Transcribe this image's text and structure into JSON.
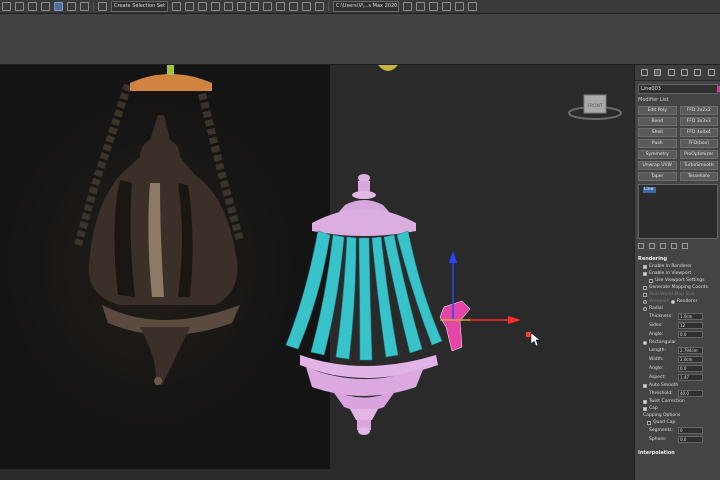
{
  "toolbar": {
    "selection_set": "Create Selection Set",
    "path": "C:\\Users\\V\\...s Max 2020"
  },
  "viewport": {
    "viewcube_label": "FRONT"
  },
  "panel": {
    "object_name": "Line003",
    "object_color": "#c2448f",
    "modifier_list_label": "Modifier List",
    "modifiers": [
      "Edit Poly",
      "FFD 2x2x2",
      "Bend",
      "FFD 3x3x3",
      "Shell",
      "FFD 4x4x4",
      "Push",
      "FFD(box)",
      "Symmetry",
      "ProOptimizer",
      "Unwrap UVW",
      "TurboSmooth",
      "Taper",
      "Tessellate"
    ],
    "stack_item": "Line",
    "rendering": {
      "title": "Rendering",
      "enable_renderer": "Enable In Renderer",
      "enable_viewport": "Enable In Viewport",
      "use_viewport_settings": "Use Viewport Settings",
      "gen_mapping": "Generate Mapping Coords.",
      "real_world": "Real-World Map Size",
      "viewport": "Viewport",
      "renderer": "Renderer",
      "radial": "Radial",
      "thickness_label": "Thickness:",
      "thickness_val": "1.0cm",
      "sides_label": "Sides:",
      "sides_val": "12",
      "angle_label": "Angle:",
      "angle_val": "0.0",
      "rectangular": "Rectangular",
      "length_label": "Length:",
      "length_val": "2.794cm",
      "width_label": "Width:",
      "width_val": "2.0cm",
      "angle2_label": "Angle:",
      "angle2_val": "0.0",
      "aspect_label": "Aspect:",
      "aspect_val": "1.47",
      "auto_smooth": "Auto Smooth",
      "threshold_label": "Threshold:",
      "threshold_val": "40.0",
      "twist": "Twist Correction",
      "cap": "Cap",
      "capping_options": "Capping Options",
      "quad_cap": "Quad Cap",
      "segments_label": "Segments:",
      "segments_val": "0",
      "sphere_label": "Sphere:",
      "sphere_val": "0.0"
    },
    "interpolation": "Interpolation"
  }
}
